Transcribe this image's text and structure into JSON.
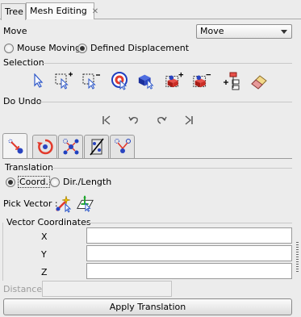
{
  "tabs": [
    {
      "label": "Tree"
    },
    {
      "label": "Mesh Editing",
      "close": "✕"
    }
  ],
  "move": {
    "label": "Move",
    "selected": "Move",
    "options": [
      "Mouse Moving",
      "Defined Displacement"
    ],
    "selected_option": "Defined Displacement"
  },
  "selection": {
    "label": "Selection",
    "icons": [
      "pointer-icon",
      "box-select-add-icon",
      "box-select-remove-icon",
      "target-select-icon",
      "cube-pointer-icon",
      "cube-add-icon",
      "cube-remove-icon",
      "tree-add-icon",
      "eraser-icon"
    ]
  },
  "do_undo": {
    "label": "Do Undo",
    "icons": [
      "first-icon",
      "undo-icon",
      "redo-icon",
      "last-icon"
    ]
  },
  "tool_tabs": [
    "translate-tab-icon",
    "rotate-tab-icon",
    "scale-tab-icon",
    "mirror-tab-icon",
    "snap-tab-icon"
  ],
  "translation": {
    "label": "Translation",
    "options": [
      "Coord.",
      "Dir./Length"
    ],
    "selected": "Coord.",
    "pick_vector_label": "Pick Vector :",
    "vector_coords_label": "Vector Coordinates",
    "fields": [
      {
        "label": "X",
        "value": ""
      },
      {
        "label": "Y",
        "value": ""
      },
      {
        "label": "Z",
        "value": ""
      }
    ],
    "distance_label": "Distance :",
    "distance_value": "",
    "apply_label": "Apply Translation"
  }
}
